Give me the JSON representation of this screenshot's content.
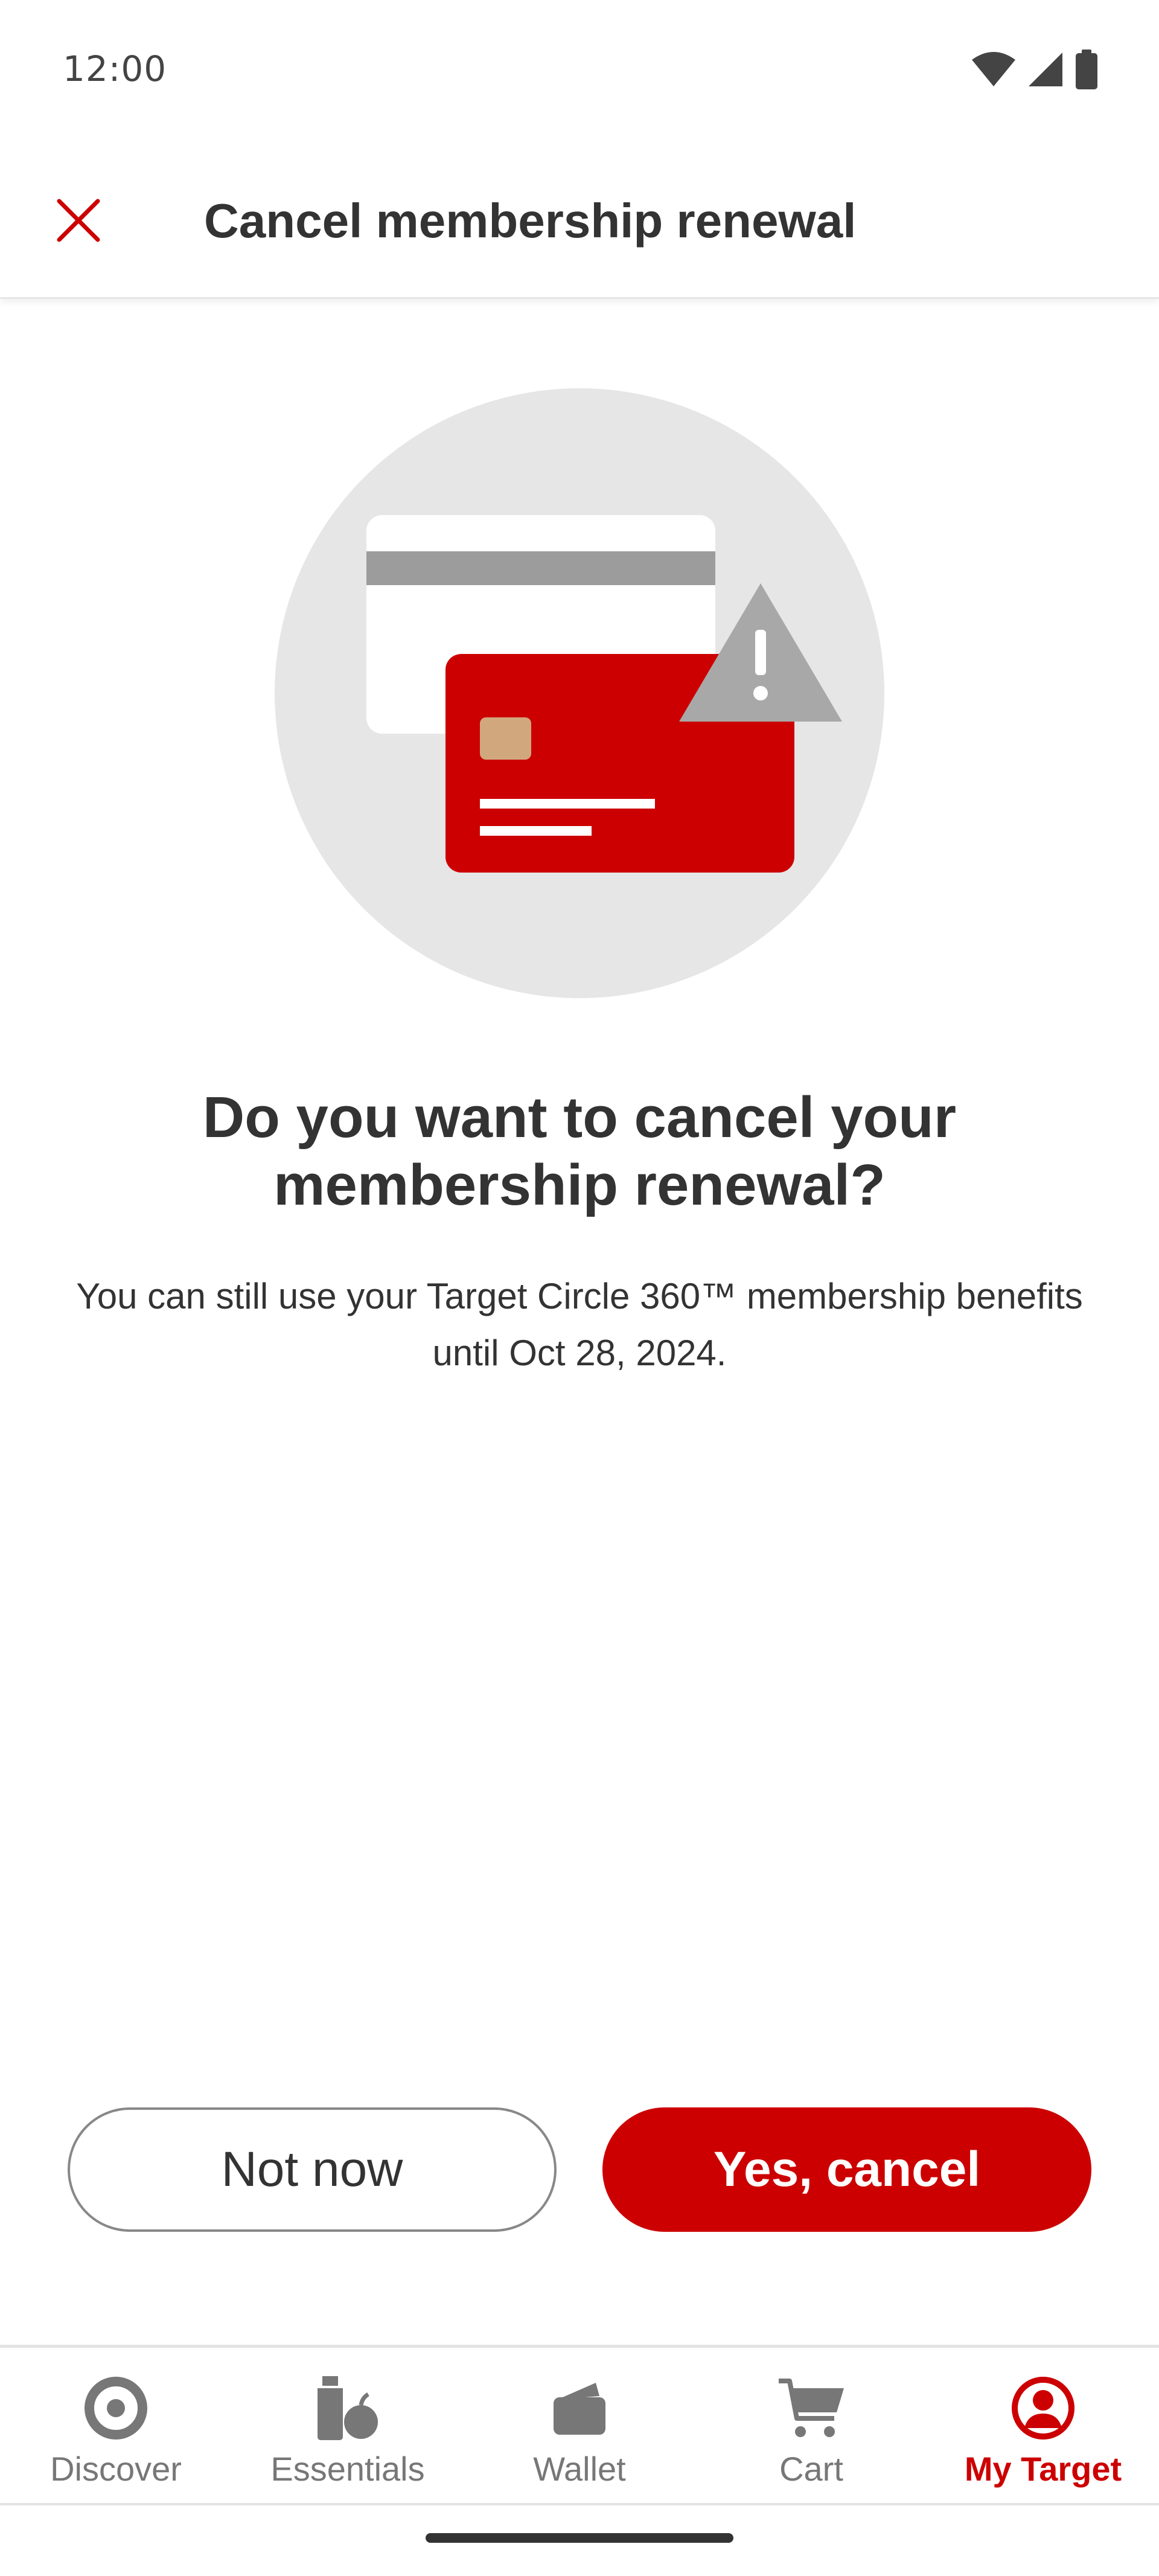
{
  "status_bar": {
    "time": "12:00"
  },
  "header": {
    "title": "Cancel membership renewal"
  },
  "content": {
    "headline_line1": "Do you want to cancel your",
    "headline_line2": "membership renewal?",
    "body_line1": "You can still use your Target Circle 360™ membership benefits",
    "body_line2": "until Oct 28, 2024."
  },
  "actions": {
    "not_now_label": "Not now",
    "yes_cancel_label": "Yes, cancel"
  },
  "bottom_nav": {
    "items": [
      {
        "label": "Discover",
        "icon": "bullseye-icon",
        "active": false
      },
      {
        "label": "Essentials",
        "icon": "essentials-icon",
        "active": false
      },
      {
        "label": "Wallet",
        "icon": "wallet-icon",
        "active": false
      },
      {
        "label": "Cart",
        "icon": "cart-icon",
        "active": false
      },
      {
        "label": "My Target",
        "icon": "account-icon",
        "active": true
      }
    ]
  },
  "colors": {
    "brand": "#cc0000",
    "text": "#333333",
    "muted": "#777777",
    "illustration_bg": "#e6e6e6"
  }
}
